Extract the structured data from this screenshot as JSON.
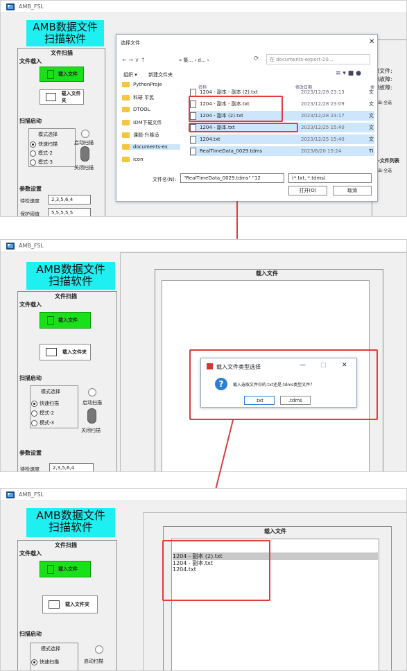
{
  "app": {
    "name": "AMB_FSL",
    "header_line1": "AMB数据文件",
    "header_line2": "扫描软件"
  },
  "sidebar": {
    "file_scan": "文件扫描",
    "file_load": "文件载入",
    "load_file": "载入文件",
    "load_folder": "载入文件夹",
    "scan_start": "扫描启动",
    "mode_select": "模式选择",
    "mode_fast": "快速扫描",
    "mode_2": "模式-2",
    "mode_3": "模式-3",
    "start_scan": "启动扫描",
    "stop_scan": "关闭扫描",
    "param_settings": "参数设置",
    "wait_speed_label": "待检速度",
    "wait_speed_value": "2,3,5,6,4",
    "protect_threshold_label": "保护阈值",
    "protect_threshold_value": "5,5,5,5,5"
  },
  "file_dialog": {
    "title": "选择文件",
    "path": "« 集... › d... ›",
    "search_placeholder": "在 documents-export-20...",
    "organize": "组织 ▾",
    "new_folder": "新建文件夹",
    "col_name": "名称",
    "col_date": "修改日期",
    "col_type": "类",
    "nav_items": [
      "PythonProje",
      "科研 平民",
      "DTOOL",
      "IDM下载文件",
      "课题-升降适",
      "documents-ex",
      "icon"
    ],
    "files": [
      {
        "name": "1204 - 副本 - 副本 (2).txt",
        "date": "2023/12/28 23:13",
        "type": "文"
      },
      {
        "name": "1204 - 副本 - 副本.txt",
        "date": "2023/12/28 23:09",
        "type": "文"
      },
      {
        "name": "1204 - 副本 (2).txt",
        "date": "2023/12/28 23:17",
        "type": "文"
      },
      {
        "name": "1204 - 副本.txt",
        "date": "2023/12/25 15:40",
        "type": "文"
      },
      {
        "name": "1204.txt",
        "date": "2023/12/25 15:40",
        "type": "文"
      },
      {
        "name": "RealTimeData_0029.tdms",
        "date": "2023/6/20 15:24",
        "type": "TI"
      }
    ],
    "filename_label": "文件名(N):",
    "filename_value": "\"RealTimeData_0029.tdms\" \"12",
    "filter": "(*.txt, *.tdms)",
    "open": "打开(O)",
    "cancel": "取消"
  },
  "right_panel": {
    "fault_file": "障文件:",
    "fault_similar": "似故障:",
    "fault_confirm": "障故障:",
    "export_all": "导出-全选",
    "list_title": "障-文件列表",
    "export_all2": "导出-全选"
  },
  "load_panel": {
    "title": "载入文件"
  },
  "type_dialog": {
    "title": "载入文件类型选择",
    "message": "载入选取文件中的.txt还是.tdms类型文件？",
    "txt_button": ".txt",
    "tdms_button": ".tdms"
  },
  "loaded_files": [
    "1204 - 副本 (2).txt",
    "1204 - 副本.txt",
    "1204.txt"
  ],
  "colors": {
    "accent_cyan": "#1ef0f2",
    "green": "#1ae01a",
    "highlight_red": "#e23b3b",
    "select_blue": "#cde6fb"
  }
}
